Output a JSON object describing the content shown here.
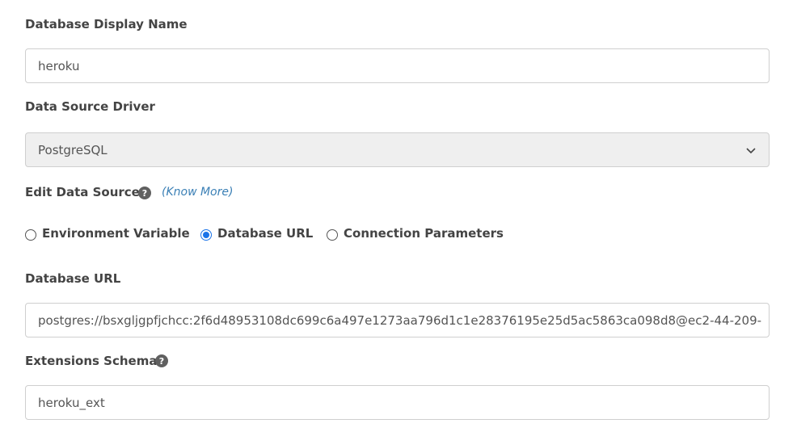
{
  "fields": {
    "display_name": {
      "label": "Database Display Name",
      "value": "heroku"
    },
    "driver": {
      "label": "Data Source Driver",
      "value": "PostgreSQL"
    },
    "edit_source": {
      "label": "Edit Data Source",
      "help": "?",
      "know_more": "(Know More)",
      "options": [
        "Environment Variable",
        "Database URL",
        "Connection Parameters"
      ],
      "selected": "Database URL"
    },
    "database_url": {
      "label": "Database URL",
      "value": "postgres://bsxgljgpfjchcc:2f6d48953108dc699c6a497e1273aa796d1c1e28376195e25d5ac5863ca098d8@ec2-44-209-"
    },
    "extensions_schema": {
      "label": "Extensions Schema",
      "help": "?",
      "value": "heroku_ext"
    }
  }
}
